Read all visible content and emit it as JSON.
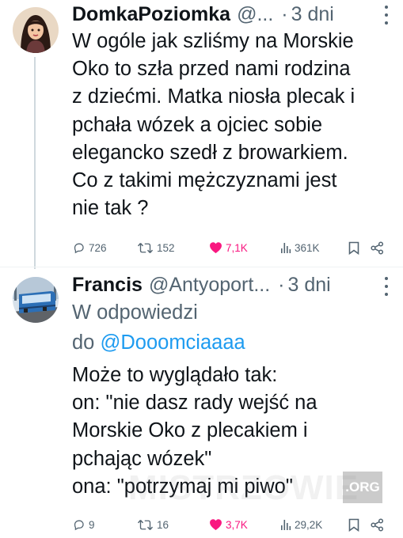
{
  "tweets": [
    {
      "author": "DomkaPoziomka",
      "handle": "@...",
      "separator": "·",
      "time": "3 dni",
      "text": "W ogóle jak szliśmy na Morskie\nOko to szła przed nami rodzina\nz dziećmi. Matka niosła plecak i\npchała wózek a ojciec sobie\nelegancko szedł z browarkiem.\nCo z takimi mężczyznami jest\nnie tak ?",
      "stats": {
        "replies": "726",
        "retweets": "152",
        "likes": "7,1K",
        "views": "361K"
      }
    },
    {
      "author": "Francis",
      "handle": "@Antyoport...",
      "separator": "·",
      "time": "3 dni",
      "reply_prefix": "W odpowiedzi",
      "reply_to_word": "do",
      "reply_to": "@Dooomciaaaa",
      "text": "Może to wyglądało tak:\non: \"nie dasz rady wejść na\nMorskie Oko z plecakiem i\npchając wózek\"\nona: \"potrzymaj mi piwo\"",
      "stats": {
        "replies": "9",
        "retweets": "16",
        "likes": "3,7K",
        "views": "29,2K"
      }
    }
  ],
  "watermark": {
    "text": "MISTRZOWIE",
    "suffix": ".ORG"
  },
  "colors": {
    "accent": "#1d9bf0",
    "like": "#f91880",
    "muted": "#536471",
    "text": "#0f1419"
  },
  "icons": [
    "more-icon",
    "reply-icon",
    "retweet-icon",
    "heart-icon",
    "views-icon",
    "bookmark-icon",
    "share-icon"
  ]
}
